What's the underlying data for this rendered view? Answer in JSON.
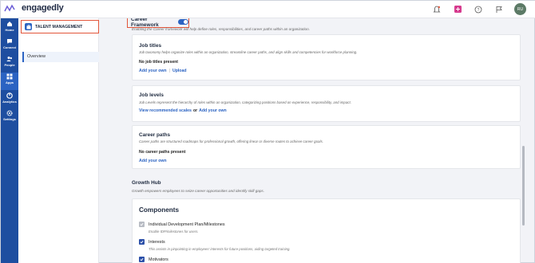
{
  "app": {
    "brand": "engagedly"
  },
  "topbar": {
    "avatar_initials": "RU"
  },
  "leftnav": {
    "items": [
      {
        "label": "Home",
        "icon": "home-icon"
      },
      {
        "label": "Connect",
        "icon": "chat-icon"
      },
      {
        "label": "People",
        "icon": "people-icon"
      },
      {
        "label": "Apps",
        "icon": "apps-icon"
      },
      {
        "label": "Analytics",
        "icon": "analytics-icon"
      },
      {
        "label": "Settings",
        "icon": "gear-icon"
      }
    ]
  },
  "subsidebar": {
    "section_title": "TALENT MANAGEMENT",
    "items": [
      {
        "label": "Overview"
      }
    ]
  },
  "career_framework": {
    "title": "Career Framework",
    "enabled": true,
    "description": "Enabling the Career framework will help define roles, responsibilities, and career paths within an organization."
  },
  "job_titles": {
    "title": "Job titles",
    "description": "Job taxonomy helps organize roles within an organization, streamline career paths, and align skills and competencies for workforce planning.",
    "note": "No job titles present",
    "link_add": "Add your own",
    "separator": "|",
    "link_upload": "Upload"
  },
  "job_levels": {
    "title": "Job levels",
    "description": "Job Levels represent the hierarchy of roles within an organization, categorizing positions based on experience, responsibility, and impact.",
    "link_scales": "View recommended scales",
    "or_text": "or",
    "link_add": "Add your own"
  },
  "career_paths": {
    "title": "Career paths",
    "description": "Career paths are structured roadmaps for professional growth, offering linear or diverse routes to achieve career goals.",
    "note": "No career paths present",
    "link_add": "Add your own"
  },
  "growth_hub": {
    "title": "Growth Hub",
    "description": "Growth empowers employees to seize career opportunities and identify skill gaps."
  },
  "components": {
    "title": "Components",
    "items": [
      {
        "label": "Individual Development Plan/Milestones",
        "description": "Enable IDP/milestones for users.",
        "checked": true,
        "disabled": true
      },
      {
        "label": "Interests",
        "description": "This assists in pinpointing in employees' interests for future positions, aiding targeted training.",
        "checked": true,
        "disabled": false
      },
      {
        "label": "Motivators",
        "description": "",
        "checked": true,
        "disabled": false
      }
    ]
  },
  "colors": {
    "accent": "#2b63c2",
    "nav_bg": "#1e4ea0",
    "highlight_box": "#e2553a"
  }
}
